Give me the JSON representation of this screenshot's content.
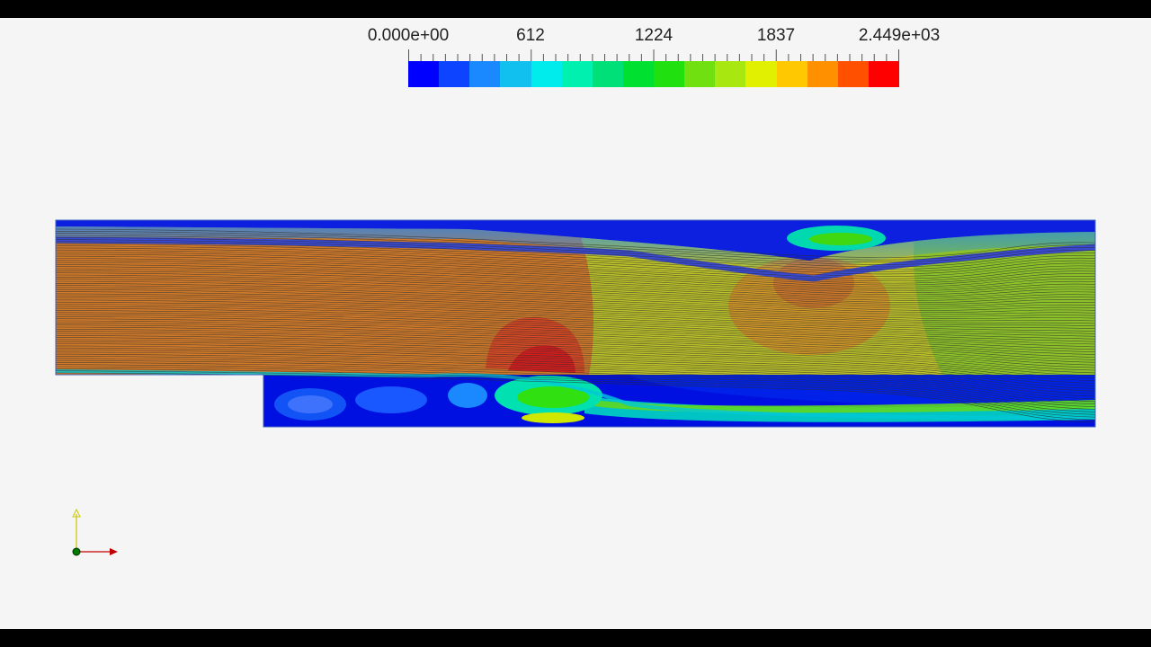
{
  "colorbar": {
    "tick_labels": [
      "0.000e+00",
      "612",
      "1224",
      "1837",
      "2.449e+03"
    ],
    "colors": [
      "#0000ff",
      "#0d44ff",
      "#1a88ff",
      "#12c0f0",
      "#00ecec",
      "#00f0b0",
      "#00e078",
      "#00e030",
      "#20e010",
      "#70e010",
      "#a8e810",
      "#e0f000",
      "#ffc800",
      "#ff9000",
      "#ff5000",
      "#ff0000"
    ]
  },
  "scene": {
    "icons": {
      "axes": "orientation-axes-icon"
    }
  }
}
